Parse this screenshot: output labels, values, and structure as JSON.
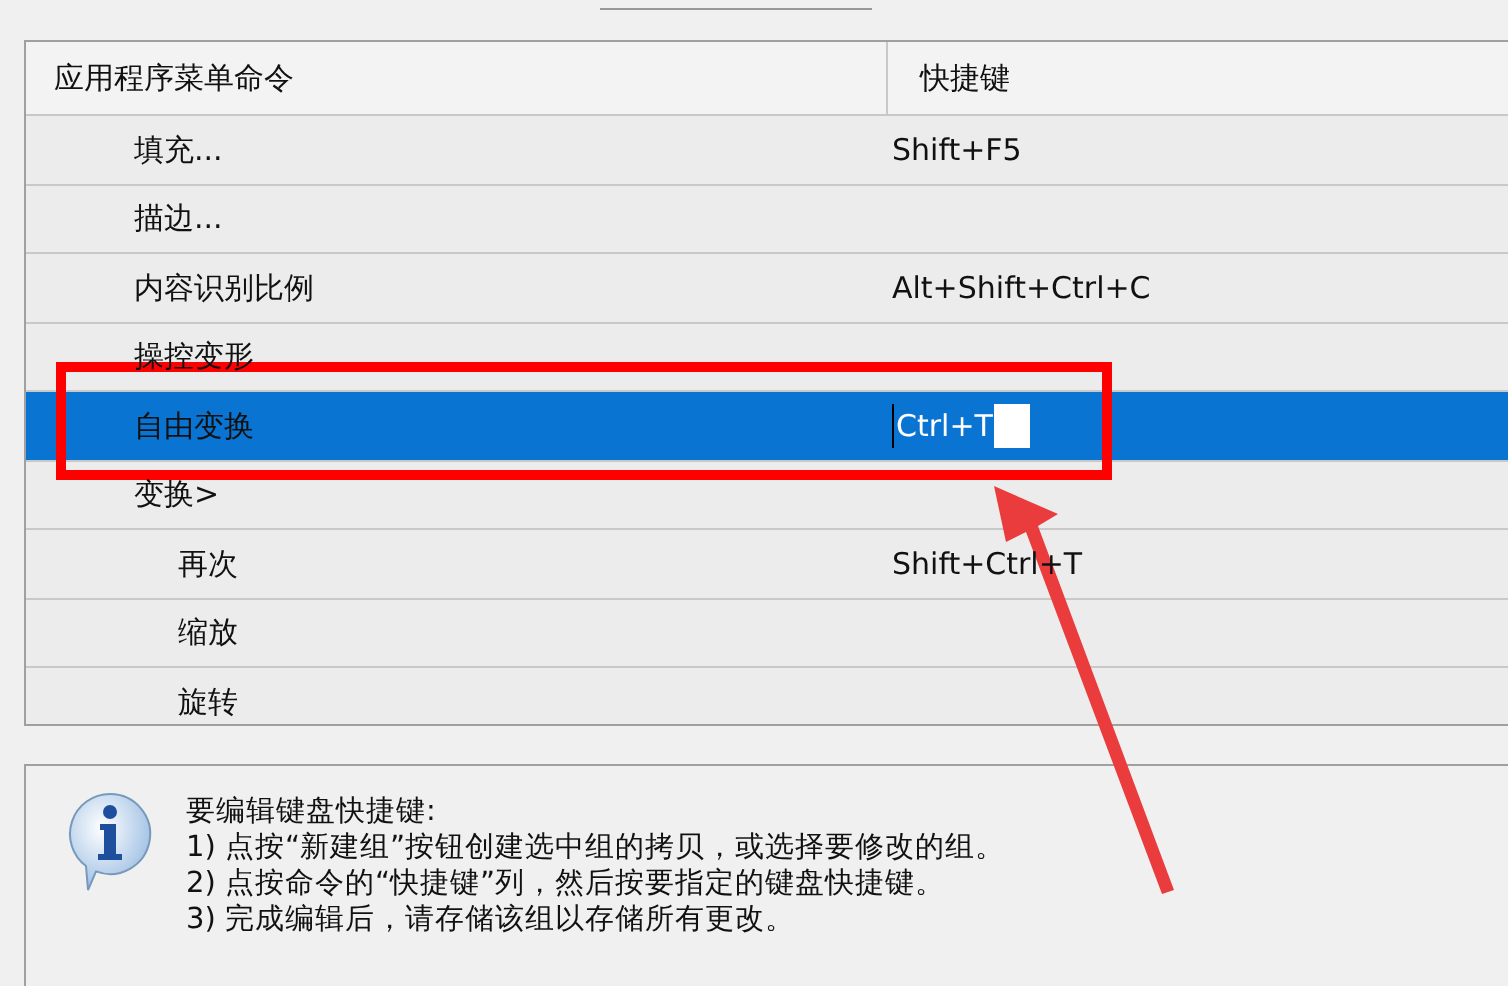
{
  "table": {
    "columns": [
      "应用程序菜单命令",
      "快捷键"
    ],
    "rows": [
      {
        "command": "填充...",
        "shortcut": "Shift+F5",
        "selected": false
      },
      {
        "command": "描边...",
        "selected": false
      },
      {
        "command": "内容识别比例",
        "shortcut": "Alt+Shift+Ctrl+C",
        "selected": false
      },
      {
        "command": "操控变形",
        "selected": false
      },
      {
        "command": "自由变换",
        "shortcut": "Ctrl+T",
        "selected": true,
        "editing": true
      },
      {
        "command": "变换>",
        "selected": false,
        "children": [
          {
            "command": "再次",
            "shortcut": "Shift+Ctrl+T",
            "selected": false
          },
          {
            "command": "缩放",
            "selected": false
          },
          {
            "command": "旋转",
            "selected": false
          }
        ]
      }
    ]
  },
  "info": {
    "lines": [
      "要编辑键盘快捷键:",
      "1) 点按“新建组”按钮创建选中组的拷贝，或选择要修改的组。",
      "2) 点按命令的“快捷键”列，然后按要指定的键盘快捷键。",
      "3) 完成编辑后，请存储该组以存储所有更改。"
    ]
  }
}
